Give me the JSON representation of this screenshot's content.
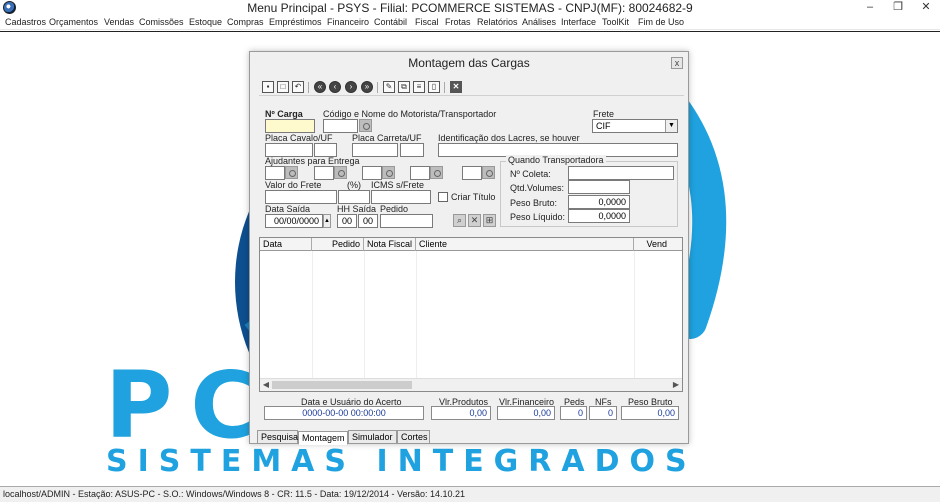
{
  "window": {
    "title": "Menu Principal - PSYS - Filial: PCOMMERCE SISTEMAS - CNPJ(MF): 80024682-9",
    "minimize": "–",
    "restore": "❐",
    "close": "✕"
  },
  "menu": [
    "Cadastros",
    "Orçamentos",
    "Vendas",
    "Comissões",
    "Estoque",
    "Compras",
    "Empréstimos",
    "Financeiro",
    "Contábil",
    "Fiscal",
    "Frotas",
    "Relatórios",
    "Análises",
    "Interface",
    "ToolKit",
    "Fim de Uso"
  ],
  "logo": {
    "text": "PCSYS",
    "tagline": "SISTEMAS INTEGRADOS",
    "brand_color": "#1fa2df",
    "globe_color": "#0d4f8f"
  },
  "dialog": {
    "title": "Montagem das Cargas",
    "close": "x",
    "toolbar_icons": [
      "save-icon",
      "new-icon",
      "undo-icon",
      "first-icon",
      "previous-icon",
      "next-icon",
      "last-icon",
      "edit-icon",
      "copy-icon",
      "report-icon",
      "delete-icon",
      "close-icon"
    ],
    "labels": {
      "nro_carga": "Nº Carga",
      "motorista": "Código e Nome do Motorista/Transportador",
      "frete": "Frete",
      "placa_cavalo": "Placa Cavalo/UF",
      "placa_carreta": "Placa Carreta/UF",
      "lacres": "Identificação dos Lacres, se houver",
      "ajudantes": "Ajudantes para Entrega",
      "valor_frete": "Valor do Frete",
      "pct": "(%)",
      "icms": "ICMS s/Frete",
      "criar_titulo": "Criar Título",
      "data_saida": "Data Saída",
      "hh_saida": "HH Saída",
      "pedido": "Pedido",
      "quando_transp": "Quando Transportadora",
      "nro_coleta": "Nº Coleta:",
      "qtd_volumes": "Qtd.Volumes:",
      "peso_bruto": "Peso Bruto:",
      "peso_liquido": "Peso Líquido:"
    },
    "values": {
      "frete": "CIF",
      "data_saida": "00/00/0000",
      "hh": "00",
      "mm": "00",
      "peso_bruto": "0,0000",
      "peso_liquido": "0,0000"
    },
    "grid_columns": [
      "Data",
      "Pedido",
      "Nota Fiscal",
      "Cliente",
      "Vend"
    ],
    "totals": {
      "acerto_label": "Data e Usuário do Acerto",
      "acerto_value": "0000-00-00 00:00:00",
      "vlr_produtos_label": "Vlr.Produtos",
      "vlr_produtos": "0,00",
      "vlr_financeiro_label": "Vlr.Financeiro",
      "vlr_financeiro": "0,00",
      "peds_label": "Peds",
      "peds": "0",
      "nfs_label": "NFs",
      "nfs": "0",
      "peso_bruto_label": "Peso Bruto",
      "peso_bruto": "0,00"
    },
    "tabs": [
      "Pesquisa",
      "Montagem",
      "Simulador",
      "Cortes"
    ],
    "active_tab": "Montagem"
  },
  "status": "localhost/ADMIN - Estação: ASUS-PC - S.O.: Windows/Windows 8 - CR: 11.5  - Data: 19/12/2014 - Versão: 14.10.21"
}
